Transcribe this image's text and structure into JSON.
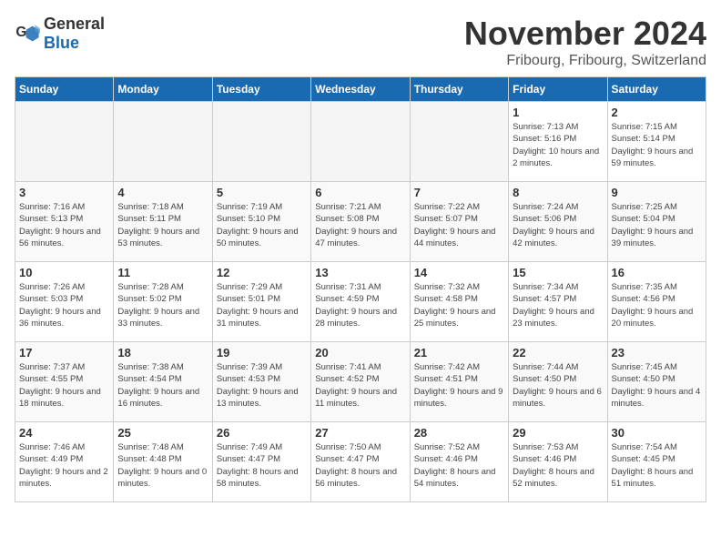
{
  "logo": {
    "text_general": "General",
    "text_blue": "Blue"
  },
  "title": "November 2024",
  "location": "Fribourg, Fribourg, Switzerland",
  "days_of_week": [
    "Sunday",
    "Monday",
    "Tuesday",
    "Wednesday",
    "Thursday",
    "Friday",
    "Saturday"
  ],
  "weeks": [
    [
      {
        "day": "",
        "info": ""
      },
      {
        "day": "",
        "info": ""
      },
      {
        "day": "",
        "info": ""
      },
      {
        "day": "",
        "info": ""
      },
      {
        "day": "",
        "info": ""
      },
      {
        "day": "1",
        "info": "Sunrise: 7:13 AM\nSunset: 5:16 PM\nDaylight: 10 hours and 2 minutes."
      },
      {
        "day": "2",
        "info": "Sunrise: 7:15 AM\nSunset: 5:14 PM\nDaylight: 9 hours and 59 minutes."
      }
    ],
    [
      {
        "day": "3",
        "info": "Sunrise: 7:16 AM\nSunset: 5:13 PM\nDaylight: 9 hours and 56 minutes."
      },
      {
        "day": "4",
        "info": "Sunrise: 7:18 AM\nSunset: 5:11 PM\nDaylight: 9 hours and 53 minutes."
      },
      {
        "day": "5",
        "info": "Sunrise: 7:19 AM\nSunset: 5:10 PM\nDaylight: 9 hours and 50 minutes."
      },
      {
        "day": "6",
        "info": "Sunrise: 7:21 AM\nSunset: 5:08 PM\nDaylight: 9 hours and 47 minutes."
      },
      {
        "day": "7",
        "info": "Sunrise: 7:22 AM\nSunset: 5:07 PM\nDaylight: 9 hours and 44 minutes."
      },
      {
        "day": "8",
        "info": "Sunrise: 7:24 AM\nSunset: 5:06 PM\nDaylight: 9 hours and 42 minutes."
      },
      {
        "day": "9",
        "info": "Sunrise: 7:25 AM\nSunset: 5:04 PM\nDaylight: 9 hours and 39 minutes."
      }
    ],
    [
      {
        "day": "10",
        "info": "Sunrise: 7:26 AM\nSunset: 5:03 PM\nDaylight: 9 hours and 36 minutes."
      },
      {
        "day": "11",
        "info": "Sunrise: 7:28 AM\nSunset: 5:02 PM\nDaylight: 9 hours and 33 minutes."
      },
      {
        "day": "12",
        "info": "Sunrise: 7:29 AM\nSunset: 5:01 PM\nDaylight: 9 hours and 31 minutes."
      },
      {
        "day": "13",
        "info": "Sunrise: 7:31 AM\nSunset: 4:59 PM\nDaylight: 9 hours and 28 minutes."
      },
      {
        "day": "14",
        "info": "Sunrise: 7:32 AM\nSunset: 4:58 PM\nDaylight: 9 hours and 25 minutes."
      },
      {
        "day": "15",
        "info": "Sunrise: 7:34 AM\nSunset: 4:57 PM\nDaylight: 9 hours and 23 minutes."
      },
      {
        "day": "16",
        "info": "Sunrise: 7:35 AM\nSunset: 4:56 PM\nDaylight: 9 hours and 20 minutes."
      }
    ],
    [
      {
        "day": "17",
        "info": "Sunrise: 7:37 AM\nSunset: 4:55 PM\nDaylight: 9 hours and 18 minutes."
      },
      {
        "day": "18",
        "info": "Sunrise: 7:38 AM\nSunset: 4:54 PM\nDaylight: 9 hours and 16 minutes."
      },
      {
        "day": "19",
        "info": "Sunrise: 7:39 AM\nSunset: 4:53 PM\nDaylight: 9 hours and 13 minutes."
      },
      {
        "day": "20",
        "info": "Sunrise: 7:41 AM\nSunset: 4:52 PM\nDaylight: 9 hours and 11 minutes."
      },
      {
        "day": "21",
        "info": "Sunrise: 7:42 AM\nSunset: 4:51 PM\nDaylight: 9 hours and 9 minutes."
      },
      {
        "day": "22",
        "info": "Sunrise: 7:44 AM\nSunset: 4:50 PM\nDaylight: 9 hours and 6 minutes."
      },
      {
        "day": "23",
        "info": "Sunrise: 7:45 AM\nSunset: 4:50 PM\nDaylight: 9 hours and 4 minutes."
      }
    ],
    [
      {
        "day": "24",
        "info": "Sunrise: 7:46 AM\nSunset: 4:49 PM\nDaylight: 9 hours and 2 minutes."
      },
      {
        "day": "25",
        "info": "Sunrise: 7:48 AM\nSunset: 4:48 PM\nDaylight: 9 hours and 0 minutes."
      },
      {
        "day": "26",
        "info": "Sunrise: 7:49 AM\nSunset: 4:47 PM\nDaylight: 8 hours and 58 minutes."
      },
      {
        "day": "27",
        "info": "Sunrise: 7:50 AM\nSunset: 4:47 PM\nDaylight: 8 hours and 56 minutes."
      },
      {
        "day": "28",
        "info": "Sunrise: 7:52 AM\nSunset: 4:46 PM\nDaylight: 8 hours and 54 minutes."
      },
      {
        "day": "29",
        "info": "Sunrise: 7:53 AM\nSunset: 4:46 PM\nDaylight: 8 hours and 52 minutes."
      },
      {
        "day": "30",
        "info": "Sunrise: 7:54 AM\nSunset: 4:45 PM\nDaylight: 8 hours and 51 minutes."
      }
    ]
  ]
}
